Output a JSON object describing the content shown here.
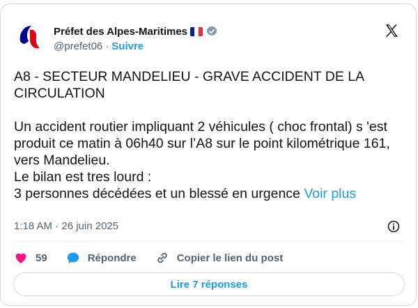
{
  "author": {
    "display_name": "Préfet des Alpes-Maritimes",
    "handle": "@prefet06",
    "separator": "·",
    "follow_label": "Suivre",
    "flag_colors": [
      "#002395",
      "#ffffff",
      "#ed2939"
    ],
    "verified_color": "#829aab"
  },
  "post": {
    "text": "A8 - SECTEUR MANDELIEU - GRAVE ACCIDENT DE LA CIRCULATION\n\nUn accident routier impliquant 2 véhicules ( choc frontal) s 'est produit ce matin à 06h40 sur l’A8 sur le point kilométrique 161, vers Mandelieu.\nLe bilan est tres lourd :\n3 personnes décédées et un blessé en urgence ",
    "see_more_label": "Voir plus",
    "timestamp": "1:18 AM · 26 juin 2025"
  },
  "actions": {
    "like_count": "59",
    "reply_label": "Répondre",
    "copy_link_label": "Copier le lien du post"
  },
  "read_replies_label": "Lire 7 réponses",
  "colors": {
    "accent": "#1d9bf0",
    "like": "#f91880",
    "secondary_text": "#536471"
  }
}
